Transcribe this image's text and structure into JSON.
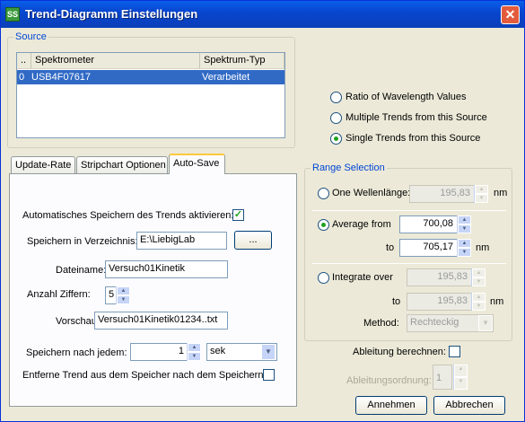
{
  "window": {
    "title": "Trend-Diagramm Einstellungen",
    "icon_text": "SS"
  },
  "source": {
    "label": "Source",
    "columns": [
      "..",
      "Spektrometer",
      "Spektrum-Typ"
    ],
    "rows": [
      {
        "index": "0",
        "spektrometer": "USB4F07617",
        "typ": "Verarbeitet"
      }
    ]
  },
  "mode": {
    "options": [
      "Ratio of Wavelength Values",
      "Multiple Trends from this Source",
      "Single Trends from this Source"
    ],
    "selected": "Single Trends from this Source"
  },
  "tabs": [
    "Update-Rate",
    "Stripchart Optionen",
    "Auto-Save"
  ],
  "active_tab": "Auto-Save",
  "autosave": {
    "enable_label": "Automatisches Speichern des Trends aktivieren:",
    "enable_checked": true,
    "dir_label": "Speichern in Verzeichnis:",
    "dir_value": "E:\\LiebigLab",
    "browse_label": "...",
    "filename_label": "Dateiname:",
    "filename_value": "Versuch01Kinetik",
    "digits_label": "Anzahl Ziffern:",
    "digits_value": "5",
    "preview_label": "Vorschau:",
    "preview_value": "Versuch01Kinetik01234..txt",
    "every_label": "Speichern nach jedem:",
    "every_value": "1",
    "unit_value": "sek",
    "remove_label": "Entferne Trend aus dem Speicher nach dem Speichern:",
    "remove_checked": false
  },
  "range": {
    "label": "Range Selection",
    "one_label": "One Wellenlänge:",
    "one_value": "195,83",
    "avg_label": "Average from",
    "avg_from": "700,08",
    "to_label": "to",
    "avg_to": "705,17",
    "int_label": "Integrate over",
    "int_from": "195,83",
    "int_to": "195,83",
    "unit": "nm",
    "method_label": "Method:",
    "method_value": "Rechteckig",
    "selected": "Average from"
  },
  "derivative": {
    "label": "Ableitung berechnen:",
    "checked": false,
    "order_label": "Ableitungsordnung:",
    "order_value": "1"
  },
  "buttons": {
    "ok": "Annehmen",
    "cancel": "Abbrechen"
  }
}
